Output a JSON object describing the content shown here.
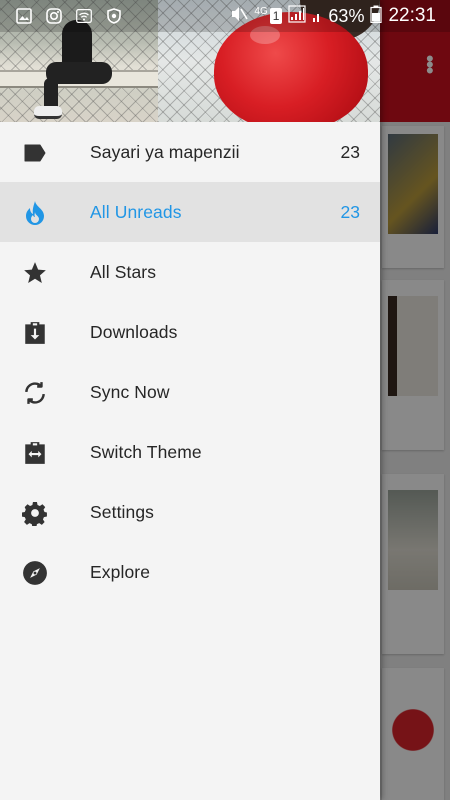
{
  "status_bar": {
    "network": "4G",
    "sim": "1",
    "battery": "63%",
    "time": "22:31"
  },
  "drawer": {
    "items": [
      {
        "label": "Sayari ya mapenzii",
        "count": "23",
        "icon": "label-icon",
        "active": false
      },
      {
        "label": "All Unreads",
        "count": "23",
        "icon": "flame-icon",
        "active": true
      },
      {
        "label": "All Stars",
        "count": "",
        "icon": "star-icon",
        "active": false
      },
      {
        "label": "Downloads",
        "count": "",
        "icon": "download-box-icon",
        "active": false
      },
      {
        "label": "Sync Now",
        "count": "",
        "icon": "sync-icon",
        "active": false
      },
      {
        "label": "Switch Theme",
        "count": "",
        "icon": "switch-theme-icon",
        "active": false
      },
      {
        "label": "Settings",
        "count": "",
        "icon": "gear-icon",
        "active": false
      },
      {
        "label": "Explore",
        "count": "",
        "icon": "compass-icon",
        "active": false
      }
    ]
  },
  "colors": {
    "accent": "#2196e5",
    "toolbar": "#c8101e",
    "drawer_bg": "#f4f4f4",
    "active_bg": "#e2e2e2",
    "icon": "#333333"
  }
}
